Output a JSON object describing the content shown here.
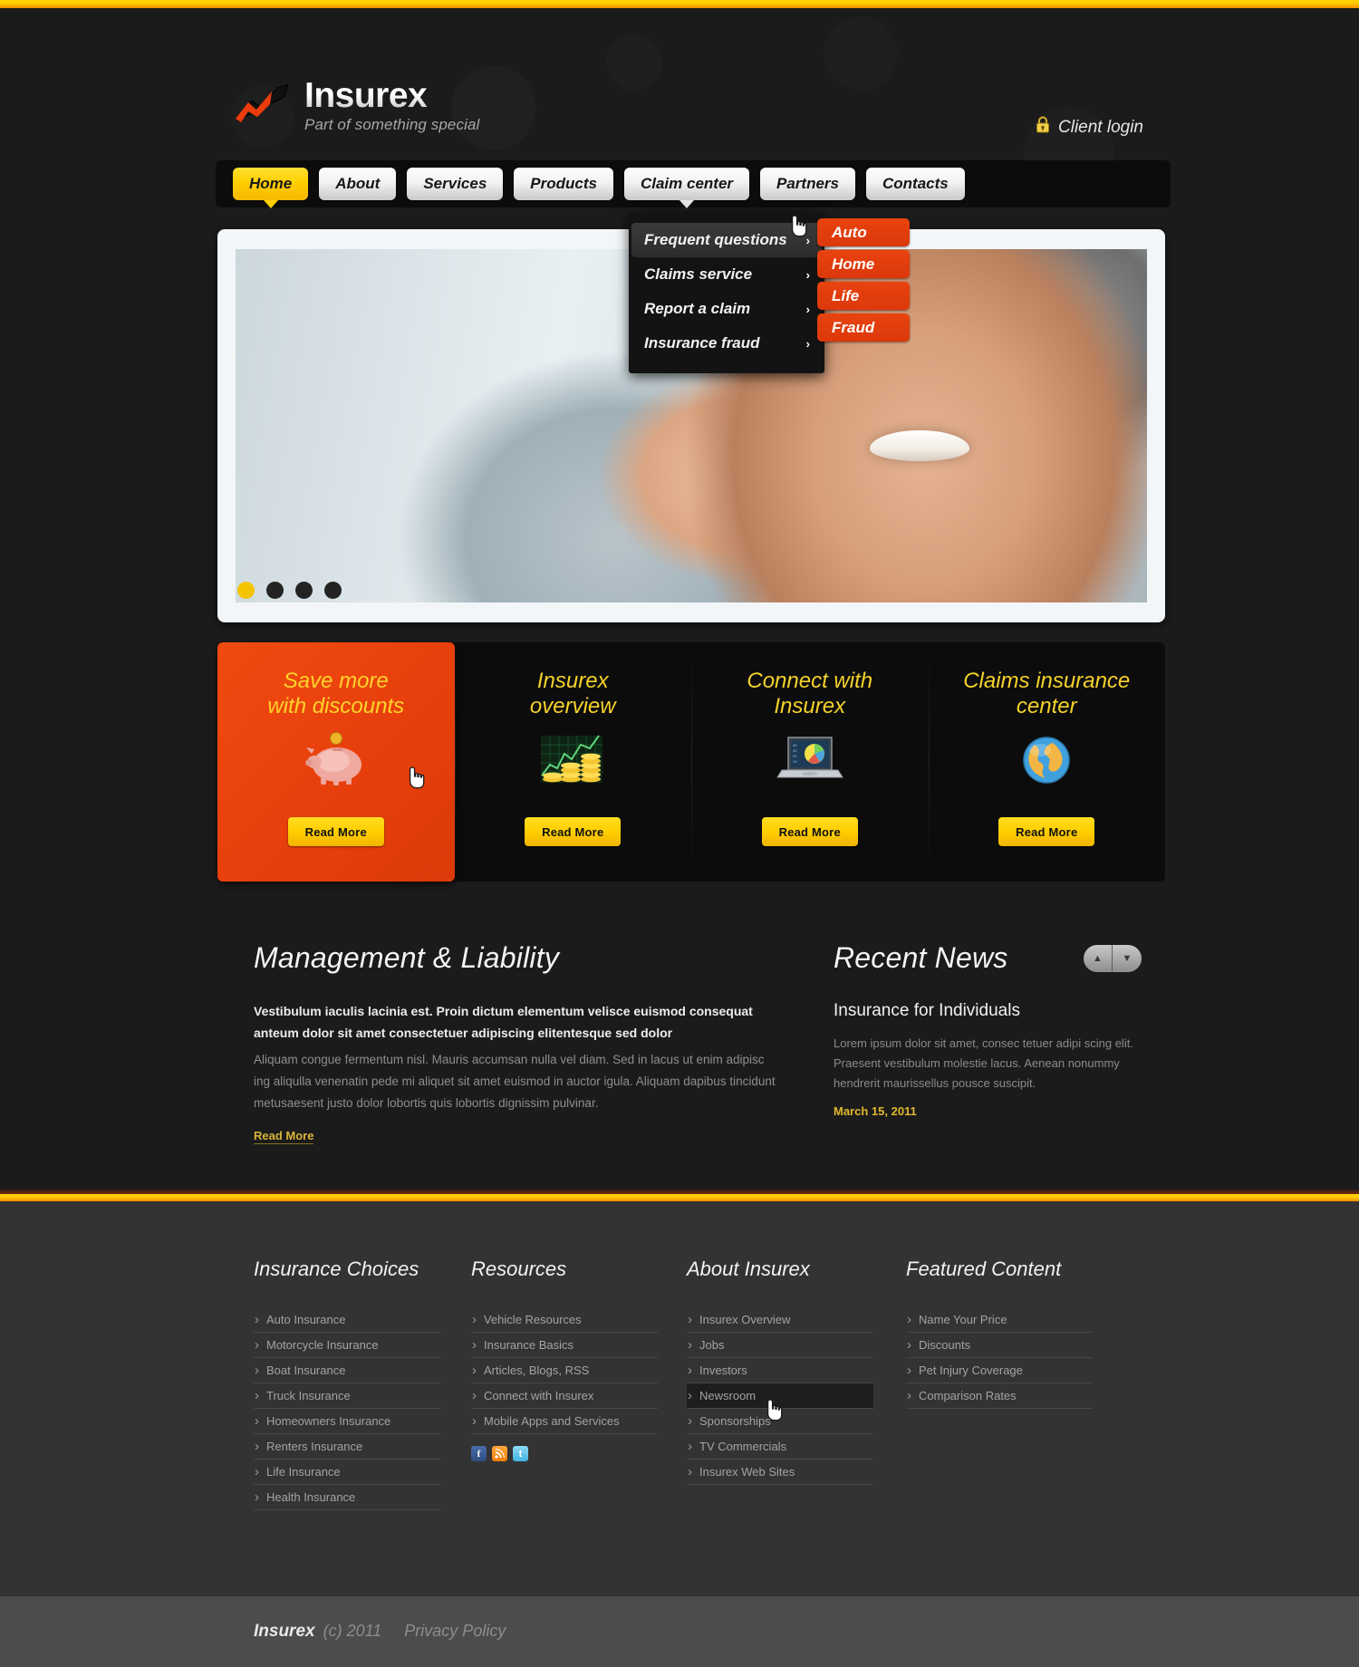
{
  "brand": {
    "name": "Insurex",
    "tagline": "Part of something special"
  },
  "header": {
    "client_login": "Client login",
    "lock_icon": "lock-icon"
  },
  "nav": {
    "items": [
      {
        "label": "Home",
        "state": "active"
      },
      {
        "label": "About",
        "state": "normal"
      },
      {
        "label": "Services",
        "state": "normal"
      },
      {
        "label": "Products",
        "state": "normal"
      },
      {
        "label": "Claim center",
        "state": "open"
      },
      {
        "label": "Partners",
        "state": "normal"
      },
      {
        "label": "Contacts",
        "state": "normal"
      }
    ]
  },
  "dropdown": {
    "items": [
      {
        "label": "Frequent questions",
        "hover": true,
        "arrow": "›"
      },
      {
        "label": "Claims service",
        "hover": false,
        "arrow": "›"
      },
      {
        "label": "Report a claim",
        "hover": false,
        "arrow": "›"
      },
      {
        "label": "Insurance fraud",
        "hover": false,
        "arrow": "›"
      }
    ]
  },
  "submenu": {
    "items": [
      "Auto",
      "Home",
      "Life",
      "Fraud"
    ]
  },
  "slider": {
    "dots": 4,
    "active_dot": 0
  },
  "promos": [
    {
      "title_line1": "Save more",
      "title_line2": "with discounts",
      "icon": "piggy-bank-icon",
      "button": "Read More",
      "featured": true
    },
    {
      "title_line1": "Insurex",
      "title_line2": "overview",
      "icon": "coins-chart-icon",
      "button": "Read More",
      "featured": false
    },
    {
      "title_line1": "Connect with",
      "title_line2": "Insurex",
      "icon": "laptop-chart-icon",
      "button": "Read More",
      "featured": false
    },
    {
      "title_line1": "Claims insurance",
      "title_line2": "center",
      "icon": "globe-icon",
      "button": "Read More",
      "featured": false
    }
  ],
  "article": {
    "title": "Management & Liability",
    "lead": "Vestibulum iaculis lacinia est. Proin dictum elementum velisce euismod consequat anteum dolor sit amet consectetuer adipiscing elitentesque sed dolor",
    "body": "Aliquam congue fermentum nisl. Mauris accumsan nulla vel diam. Sed in lacus ut enim adipisc ing aliqulla venenatin pede mi aliquet sit amet euismod in auctor igula. Aliquam dapibus tincidunt metusaesent justo dolor lobortis quis lobortis dignissim pulvinar.",
    "read_more": "Read More"
  },
  "news": {
    "title": "Recent News",
    "prev_icon": "chevron-up-icon",
    "next_icon": "chevron-down-icon",
    "headline": "Insurance for Individuals",
    "body": "Lorem ipsum dolor sit amet, consec tetuer adipi scing elit. Praesent vestibulum molestie lacus. Aenean nonummy hendrerit maurissellus pousce suscipit.",
    "date": "March 15, 2011"
  },
  "footer": {
    "columns": [
      {
        "title": "Insurance Choices",
        "links": [
          "Auto Insurance",
          "Motorcycle Insurance",
          "Boat Insurance",
          "Truck Insurance",
          "Homeowners Insurance",
          "Renters Insurance",
          "Life Insurance",
          "Health Insurance"
        ]
      },
      {
        "title": "Resources",
        "links": [
          "Vehicle Resources",
          "Insurance Basics",
          "Articles, Blogs, RSS",
          "Connect with Insurex",
          "Mobile Apps and Services"
        ],
        "social": [
          "facebook-icon",
          "rss-icon",
          "twitter-icon"
        ]
      },
      {
        "title": "About Insurex",
        "links": [
          "Insurex Overview",
          "Jobs",
          "Investors",
          "Newsroom",
          "Sponsorships",
          "TV Commercials",
          "Insurex Web Sites"
        ],
        "highlight_index": 3
      },
      {
        "title": "Featured Content",
        "links": [
          "Name Your Price",
          "Discounts",
          "Pet Injury Coverage",
          "Comparison Rates"
        ]
      }
    ]
  },
  "copyright": {
    "brand": "Insurex",
    "year": "(c) 2011",
    "privacy": "Privacy Policy"
  },
  "colors": {
    "accent_yellow": "#ffd000",
    "accent_orange": "#e8430f",
    "page_bg": "#1b1b1b",
    "footer_bg": "#333333",
    "copyright_bg": "#4c4c4c"
  }
}
